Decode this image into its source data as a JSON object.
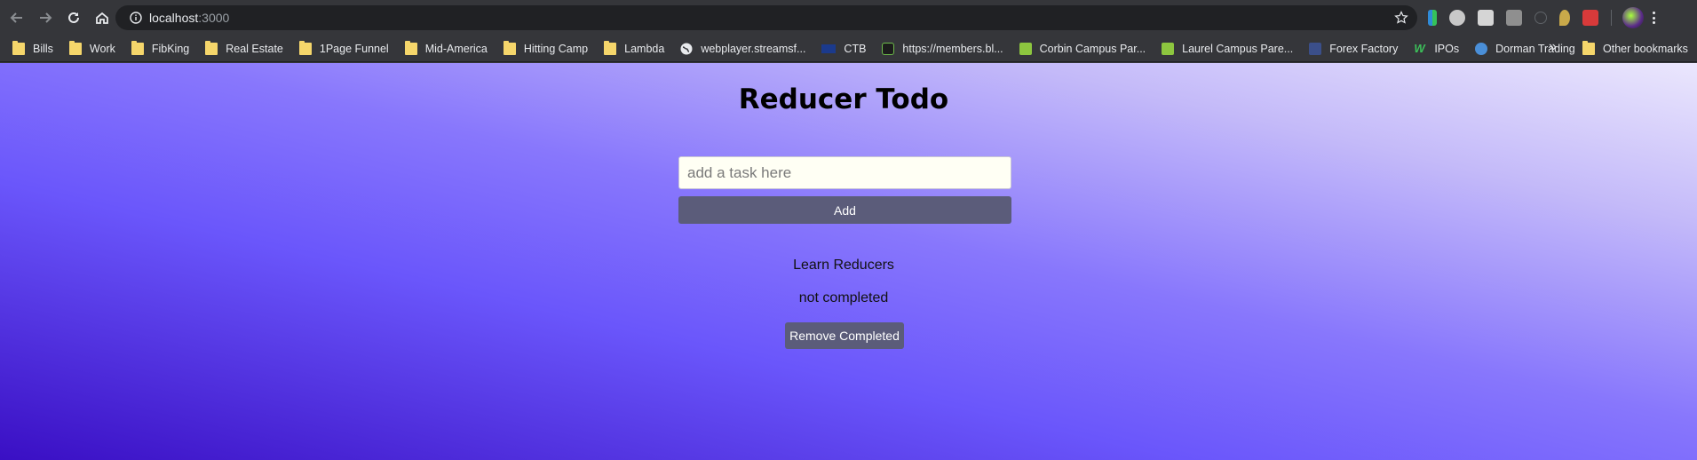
{
  "browser": {
    "url_host": "localhost",
    "url_port": ":3000",
    "bookmarks": [
      {
        "label": "Bills",
        "icon": "folder-icon"
      },
      {
        "label": "Work",
        "icon": "folder-icon"
      },
      {
        "label": "FibKing",
        "icon": "folder-icon"
      },
      {
        "label": "Real Estate",
        "icon": "folder-icon"
      },
      {
        "label": "1Page Funnel",
        "icon": "folder-icon"
      },
      {
        "label": "Mid-America",
        "icon": "folder-icon"
      },
      {
        "label": "Hitting Camp",
        "icon": "folder-icon"
      },
      {
        "label": "Lambda",
        "icon": "folder-icon"
      },
      {
        "label": "webplayer.streamsf...",
        "icon": "globe-icon"
      },
      {
        "label": "CTB",
        "icon": "ibm-icon"
      },
      {
        "label": "https://members.bl...",
        "icon": "site-icon"
      },
      {
        "label": "Corbin Campus Par...",
        "icon": "c-icon"
      },
      {
        "label": "Laurel Campus Pare...",
        "icon": "c-icon"
      },
      {
        "label": "Forex Factory",
        "icon": "forex-icon"
      },
      {
        "label": "IPOs",
        "icon": "w-icon"
      },
      {
        "label": "Dorman Trading",
        "icon": "dorman-icon"
      }
    ],
    "more_bookmarks": "»",
    "other_bookmarks": "Other bookmarks"
  },
  "app": {
    "title": "Reducer Todo",
    "input_placeholder": "add a task here",
    "input_value": "",
    "add_label": "Add",
    "todo_item": {
      "text": "Learn Reducers",
      "status": "not completed"
    },
    "remove_label": "Remove Completed"
  }
}
